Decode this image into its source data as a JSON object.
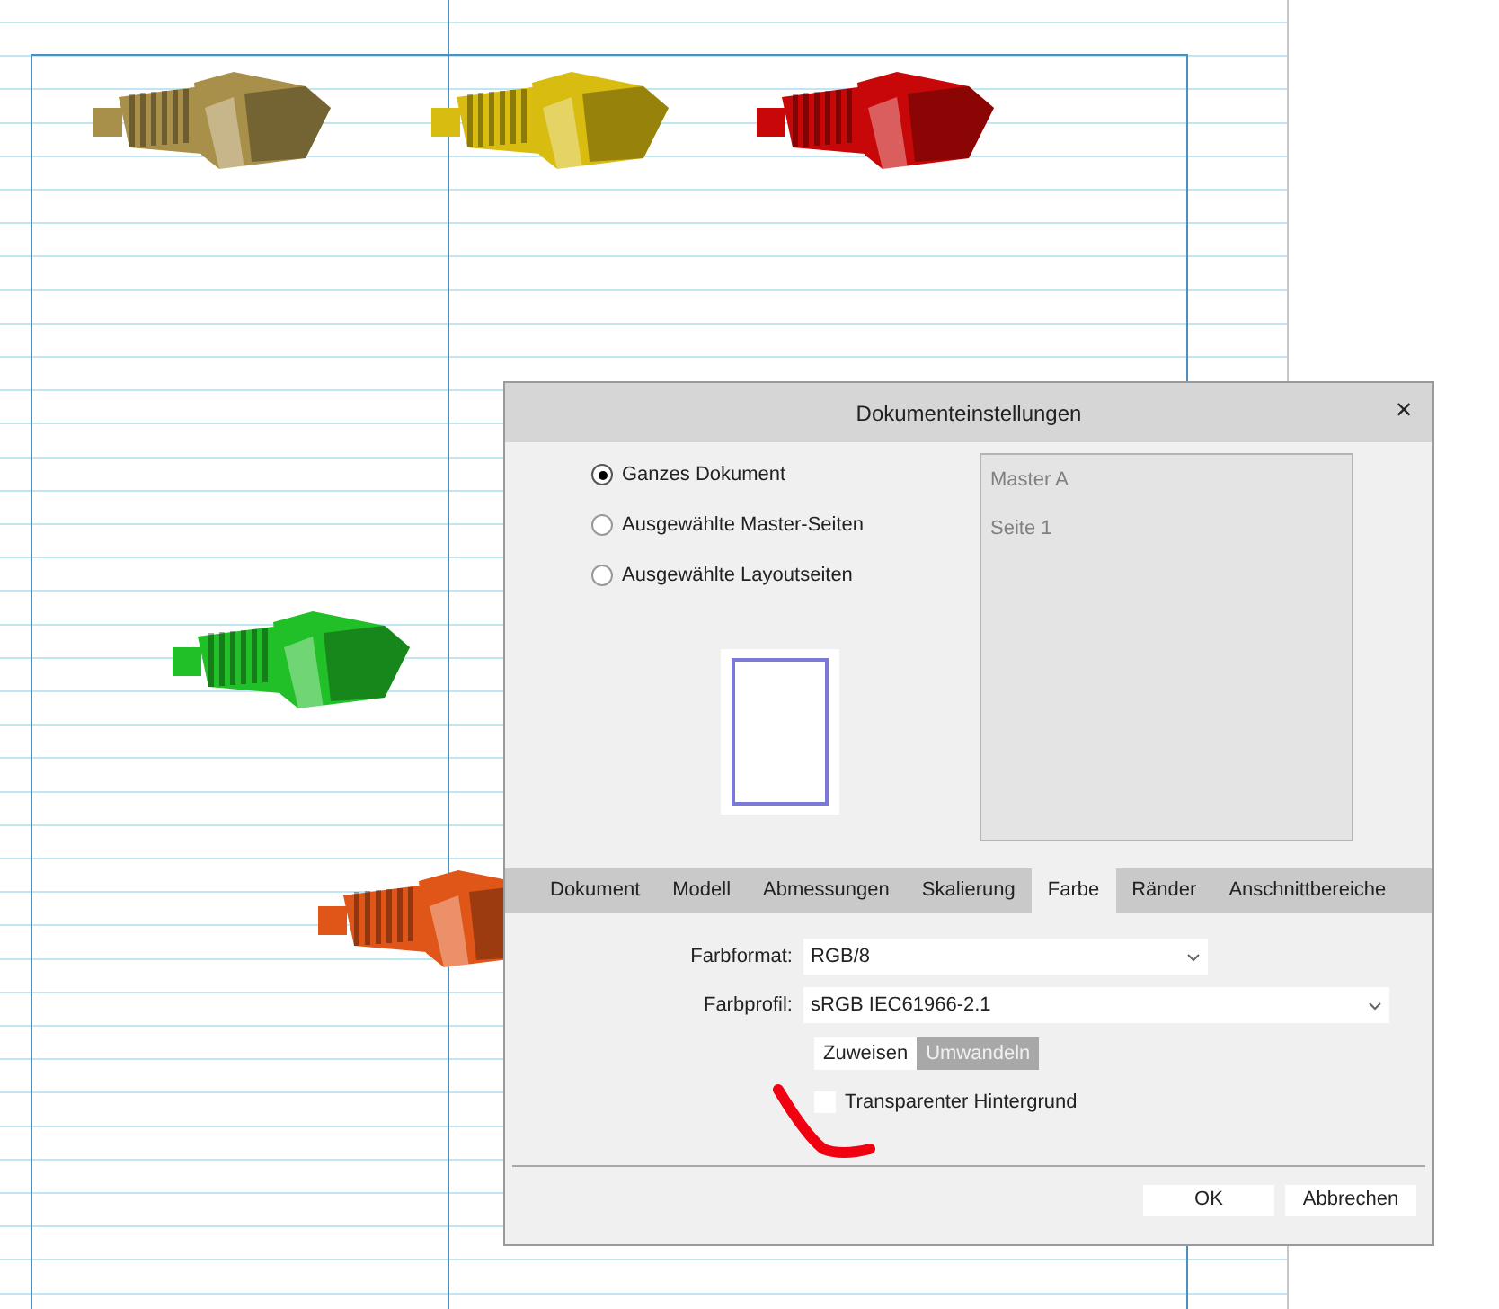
{
  "canvas": {
    "connectors": [
      {
        "color": "#a8904a"
      },
      {
        "color": "#d8bc10"
      },
      {
        "color": "#c80808"
      },
      {
        "color": "#22c028"
      },
      {
        "color": "#e05518"
      }
    ]
  },
  "dialog": {
    "title": "Dokumenteinstellungen",
    "close": "×",
    "scope_options": [
      {
        "label": "Ganzes Dokument",
        "selected": true
      },
      {
        "label": "Ausgewählte Master-Seiten",
        "selected": false
      },
      {
        "label": "Ausgewählte Layoutseiten",
        "selected": false
      }
    ],
    "page_list": [
      "Master A",
      "Seite 1"
    ],
    "tabs": [
      {
        "label": "Dokument",
        "selected": false
      },
      {
        "label": "Modell",
        "selected": false
      },
      {
        "label": "Abmessungen",
        "selected": false
      },
      {
        "label": "Skalierung",
        "selected": false
      },
      {
        "label": "Farbe",
        "selected": true
      },
      {
        "label": "Ränder",
        "selected": false
      },
      {
        "label": "Anschnittbereiche",
        "selected": false
      }
    ],
    "fields": [
      {
        "label": "Farbformat:",
        "value": "RGB/8"
      },
      {
        "label": "Farbprofil:",
        "value": "sRGB IEC61966-2.1"
      }
    ],
    "profile_actions": [
      {
        "label": "Zuweisen",
        "selected": false
      },
      {
        "label": "Umwandeln",
        "selected": true
      }
    ],
    "checkbox": {
      "label": "Transparenter Hintergrund",
      "checked": false
    },
    "buttons": [
      "OK",
      "Abbrechen"
    ]
  }
}
